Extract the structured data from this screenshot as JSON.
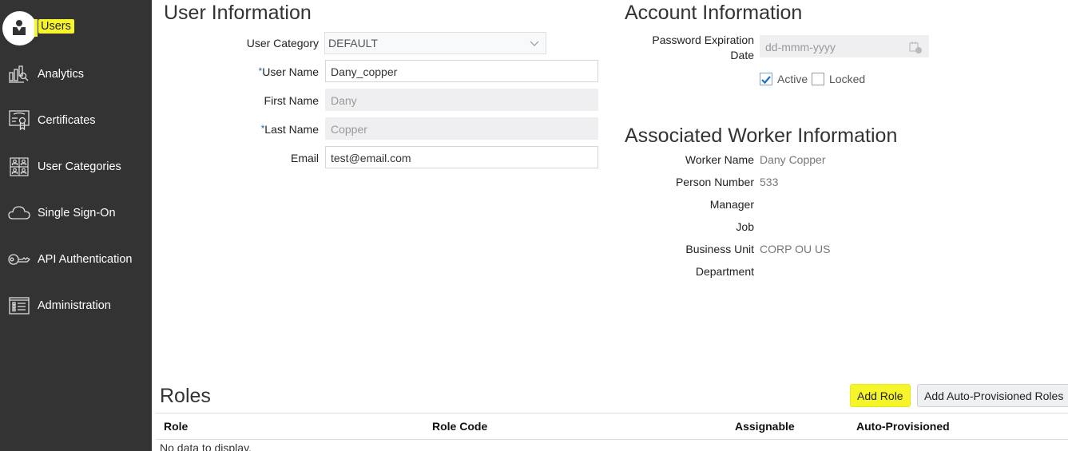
{
  "sidebar": {
    "items": [
      {
        "label": "Users",
        "icon": "user-icon",
        "active": true
      },
      {
        "label": "Analytics",
        "icon": "analytics-icon"
      },
      {
        "label": "Certificates",
        "icon": "certificate-icon"
      },
      {
        "label": "User Categories",
        "icon": "user-categories-icon"
      },
      {
        "label": "Single Sign-On",
        "icon": "cloud-icon"
      },
      {
        "label": "API Authentication",
        "icon": "key-icon"
      },
      {
        "label": "Administration",
        "icon": "administration-icon"
      }
    ],
    "highlight_color": "#f5f52a"
  },
  "user_info": {
    "title": "User Information",
    "user_category": {
      "label": "User Category",
      "value": "DEFAULT"
    },
    "user_name": {
      "label": "User Name",
      "required": "*",
      "value": "Dany_copper"
    },
    "first_name": {
      "label": "First Name",
      "value": "Dany"
    },
    "last_name": {
      "label": "Last Name",
      "required": "*",
      "value": "Copper"
    },
    "email": {
      "label": "Email",
      "value": "test@email.com"
    }
  },
  "account_info": {
    "title": "Account Information",
    "password_expiration": {
      "label_line1": "Password Expiration",
      "label_line2": "Date",
      "placeholder": "dd-mmm-yyyy"
    },
    "active": {
      "label": "Active",
      "checked": true
    },
    "locked": {
      "label": "Locked",
      "checked": false
    }
  },
  "worker_info": {
    "title": "Associated Worker Information",
    "rows": [
      {
        "label": "Worker Name",
        "value": "Dany Copper"
      },
      {
        "label": "Person Number",
        "value": "533"
      },
      {
        "label": "Manager",
        "value": ""
      },
      {
        "label": "Job",
        "value": ""
      },
      {
        "label": "Business Unit",
        "value": "CORP OU US"
      },
      {
        "label": "Department",
        "value": ""
      }
    ]
  },
  "roles": {
    "title": "Roles",
    "add_role_label": "Add Role",
    "add_auto_label": "Add Auto-Provisioned Roles",
    "columns": [
      "Role",
      "Role Code",
      "Assignable",
      "Auto-Provisioned"
    ],
    "empty_text": "No data to display."
  }
}
